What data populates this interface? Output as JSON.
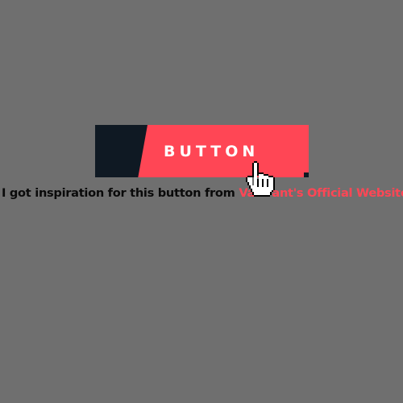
{
  "button": {
    "label": "BUTTON",
    "colors": {
      "dark": "#0f1923",
      "accent": "#ff4655",
      "text": "#ffffff"
    }
  },
  "caption": {
    "prefix": "I got inspiration for this button from ",
    "link_text": "Valorant's Official Website",
    "link_color": "#ff4655"
  },
  "cursor": {
    "icon": "pointer-hand-icon"
  }
}
